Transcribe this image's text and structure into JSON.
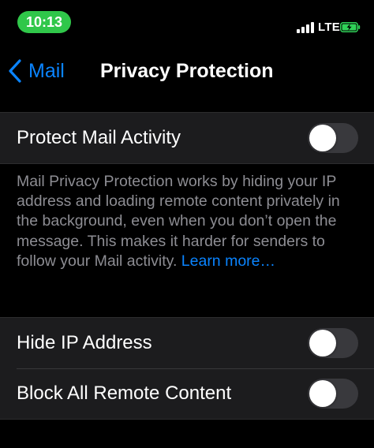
{
  "status_bar": {
    "time": "10:13",
    "network": "LTE",
    "signal_bars_filled": 4,
    "battery_state": "charging"
  },
  "nav": {
    "back_label": "Mail",
    "title": "Privacy Protection"
  },
  "protect_group": {
    "label": "Protect Mail Activity",
    "toggle_on": false
  },
  "description": {
    "text": "Mail Privacy Protection works by hiding your IP address and loading remote content privately in the background, even when you don’t open the message. This makes it harder for senders to follow your Mail activity.",
    "link": "Learn more…"
  },
  "options_group": {
    "items": [
      {
        "label": "Hide IP Address",
        "toggle_on": false
      },
      {
        "label": "Block All Remote Content",
        "toggle_on": false
      }
    ]
  },
  "colors": {
    "accent": "#0a84ff",
    "time_pill": "#30c74a",
    "cell_background": "#1c1c1e",
    "toggle_off": "#39393d",
    "battery_fill": "#30d158"
  }
}
